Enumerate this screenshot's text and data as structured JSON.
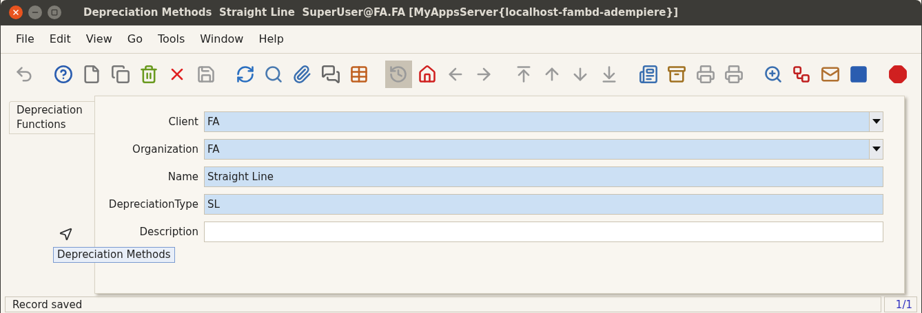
{
  "window": {
    "title": "Depreciation Methods  Straight Line  SuperUser@FA.FA [MyAppsServer{localhost-fambd-adempiere}]"
  },
  "menu": [
    {
      "label": "File"
    },
    {
      "label": "Edit"
    },
    {
      "label": "View"
    },
    {
      "label": "Go"
    },
    {
      "label": "Tools"
    },
    {
      "label": "Window"
    },
    {
      "label": "Help"
    }
  ],
  "toolbar": [
    {
      "kind": "undo",
      "disabled": true,
      "selected": false,
      "group_start": false
    },
    {
      "kind": "help",
      "disabled": false,
      "selected": false,
      "group_start": true
    },
    {
      "kind": "new",
      "disabled": false,
      "selected": false,
      "group_start": false
    },
    {
      "kind": "copy",
      "disabled": false,
      "selected": false,
      "group_start": false
    },
    {
      "kind": "trash",
      "disabled": false,
      "selected": false,
      "group_start": false
    },
    {
      "kind": "cross",
      "disabled": false,
      "selected": false,
      "group_start": false
    },
    {
      "kind": "save",
      "disabled": true,
      "selected": false,
      "group_start": false
    },
    {
      "kind": "refresh",
      "disabled": false,
      "selected": false,
      "group_start": true
    },
    {
      "kind": "search",
      "disabled": false,
      "selected": false,
      "group_start": false
    },
    {
      "kind": "paperclip",
      "disabled": false,
      "selected": false,
      "group_start": false
    },
    {
      "kind": "chat",
      "disabled": false,
      "selected": false,
      "group_start": false
    },
    {
      "kind": "grid",
      "disabled": false,
      "selected": false,
      "group_start": false
    },
    {
      "kind": "history",
      "disabled": true,
      "selected": true,
      "group_start": true
    },
    {
      "kind": "home",
      "disabled": false,
      "selected": false,
      "group_start": false
    },
    {
      "kind": "left",
      "disabled": true,
      "selected": false,
      "group_start": false
    },
    {
      "kind": "right",
      "disabled": true,
      "selected": false,
      "group_start": false
    },
    {
      "kind": "first",
      "disabled": true,
      "selected": false,
      "group_start": true
    },
    {
      "kind": "up",
      "disabled": true,
      "selected": false,
      "group_start": false
    },
    {
      "kind": "down",
      "disabled": true,
      "selected": false,
      "group_start": false
    },
    {
      "kind": "last",
      "disabled": true,
      "selected": false,
      "group_start": false
    },
    {
      "kind": "report",
      "disabled": false,
      "selected": false,
      "group_start": true
    },
    {
      "kind": "archive",
      "disabled": false,
      "selected": false,
      "group_start": false
    },
    {
      "kind": "printer",
      "disabled": true,
      "selected": false,
      "group_start": false
    },
    {
      "kind": "printer",
      "disabled": true,
      "selected": false,
      "group_start": false
    },
    {
      "kind": "zoom",
      "disabled": false,
      "selected": false,
      "group_start": true
    },
    {
      "kind": "workflow",
      "disabled": false,
      "selected": false,
      "group_start": false
    },
    {
      "kind": "mail",
      "disabled": false,
      "selected": false,
      "group_start": false
    },
    {
      "kind": "block",
      "disabled": false,
      "selected": false,
      "group_start": false
    },
    {
      "kind": "exit",
      "disabled": false,
      "selected": false,
      "group_start": true
    }
  ],
  "tabs": [
    {
      "label": "Depreciation Functions",
      "selected": true
    }
  ],
  "fields": [
    {
      "label": "Client",
      "value": "FA",
      "kind": "combo",
      "mandatory": true
    },
    {
      "label": "Organization",
      "value": "FA",
      "kind": "combo",
      "mandatory": true
    },
    {
      "label": "Name",
      "value": "Straight Line",
      "kind": "text",
      "mandatory": true
    },
    {
      "label": "DepreciationType",
      "value": "SL",
      "kind": "text",
      "mandatory": true
    },
    {
      "label": "Description",
      "kind": "text",
      "mandatory": false
    }
  ],
  "tooltip": "Depreciation Methods",
  "status_bar": {
    "message": "Record saved",
    "record": "1/1"
  }
}
